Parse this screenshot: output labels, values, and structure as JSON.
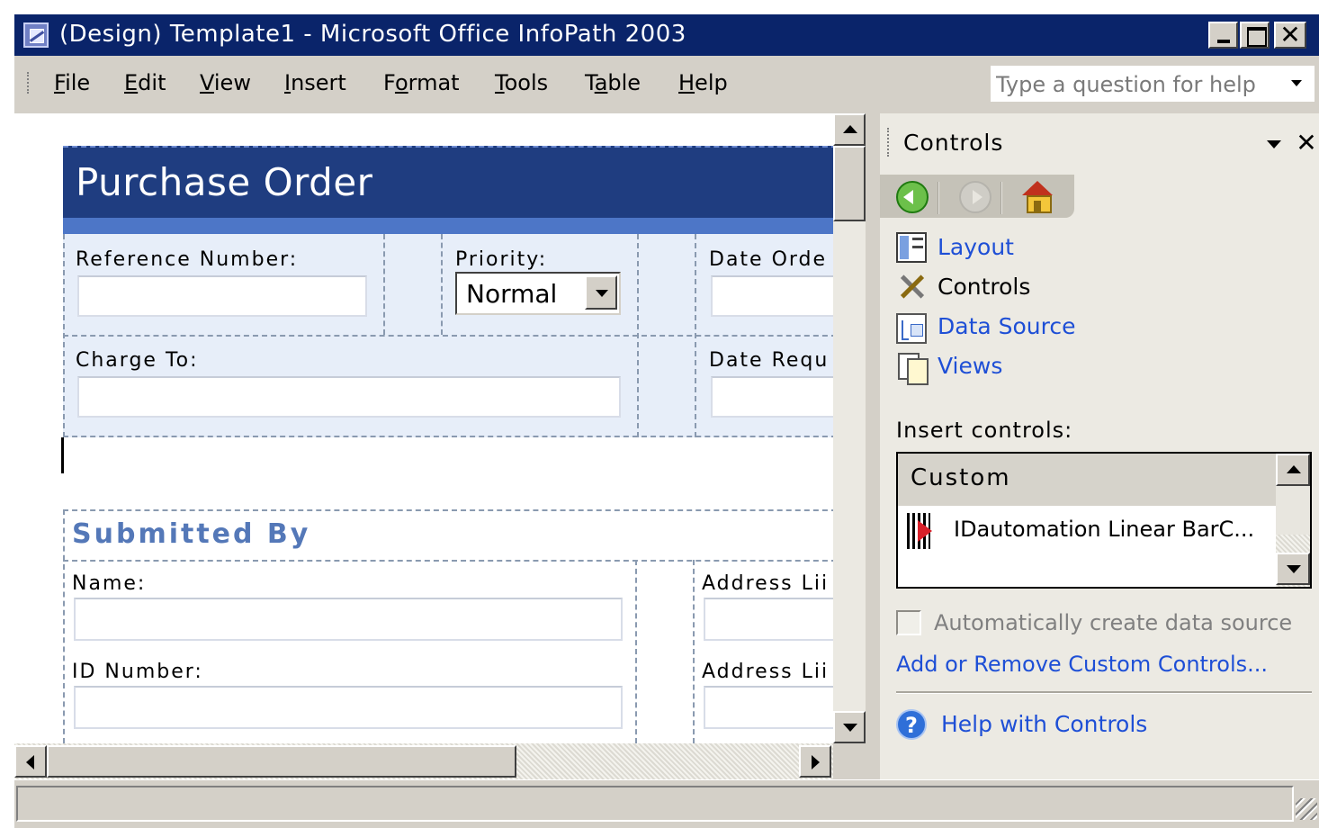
{
  "window": {
    "title": "(Design) Template1 - Microsoft Office InfoPath 2003",
    "close_glyph": "✕"
  },
  "menu": {
    "items": [
      {
        "pre": "",
        "key": "F",
        "post": "ile"
      },
      {
        "pre": "",
        "key": "E",
        "post": "dit"
      },
      {
        "pre": "",
        "key": "V",
        "post": "iew"
      },
      {
        "pre": "",
        "key": "I",
        "post": "nsert"
      },
      {
        "pre": "F",
        "key": "o",
        "post": "rmat"
      },
      {
        "pre": "",
        "key": "T",
        "post": "ools"
      },
      {
        "pre": "T",
        "key": "a",
        "post": "ble"
      },
      {
        "pre": "",
        "key": "H",
        "post": "elp"
      }
    ],
    "help_placeholder": "Type a question for help"
  },
  "form": {
    "title": "Purchase Order",
    "reference_label": "Reference Number:",
    "priority_label": "Priority:",
    "priority_value": "Normal",
    "date_ordered_label": "Date Orde",
    "charge_to_label": "Charge To:",
    "date_required_label": "Date Requ",
    "submitted_by_heading": "Submitted By",
    "name_label": "Name:",
    "address1_label": "Address Lii",
    "id_number_label": "ID Number:",
    "address2_label": "Address Lii"
  },
  "taskpane": {
    "title": "Controls",
    "close_glyph": "✕",
    "links": {
      "layout": "Layout",
      "controls": "Controls",
      "data_source": "Data Source",
      "views": "Views"
    },
    "insert_controls_label": "Insert controls:",
    "custom_category": "Custom",
    "custom_items": [
      "IDautomation Linear BarC..."
    ],
    "auto_create_label": "Automatically create data source",
    "auto_create_checked": false,
    "add_remove_link": "Add or Remove Custom Controls...",
    "help_link": "Help with Controls",
    "help_glyph": "?"
  },
  "icons": {
    "app": "infopath-app-icon",
    "back": "back-arrow-icon",
    "forward": "forward-arrow-icon",
    "home": "home-icon",
    "layout": "layout-icon",
    "controls": "controls-tools-icon",
    "data_source": "data-source-icon",
    "views": "views-icon",
    "barcode": "barcode-icon",
    "help": "help-icon"
  },
  "colors": {
    "titlebar": "#0a246a",
    "form_header": "#1f3d80",
    "form_band": "#4d76c7",
    "section_fill": "#e7eef9",
    "link": "#1e4fd6",
    "submitted_heading": "#5478b8"
  }
}
